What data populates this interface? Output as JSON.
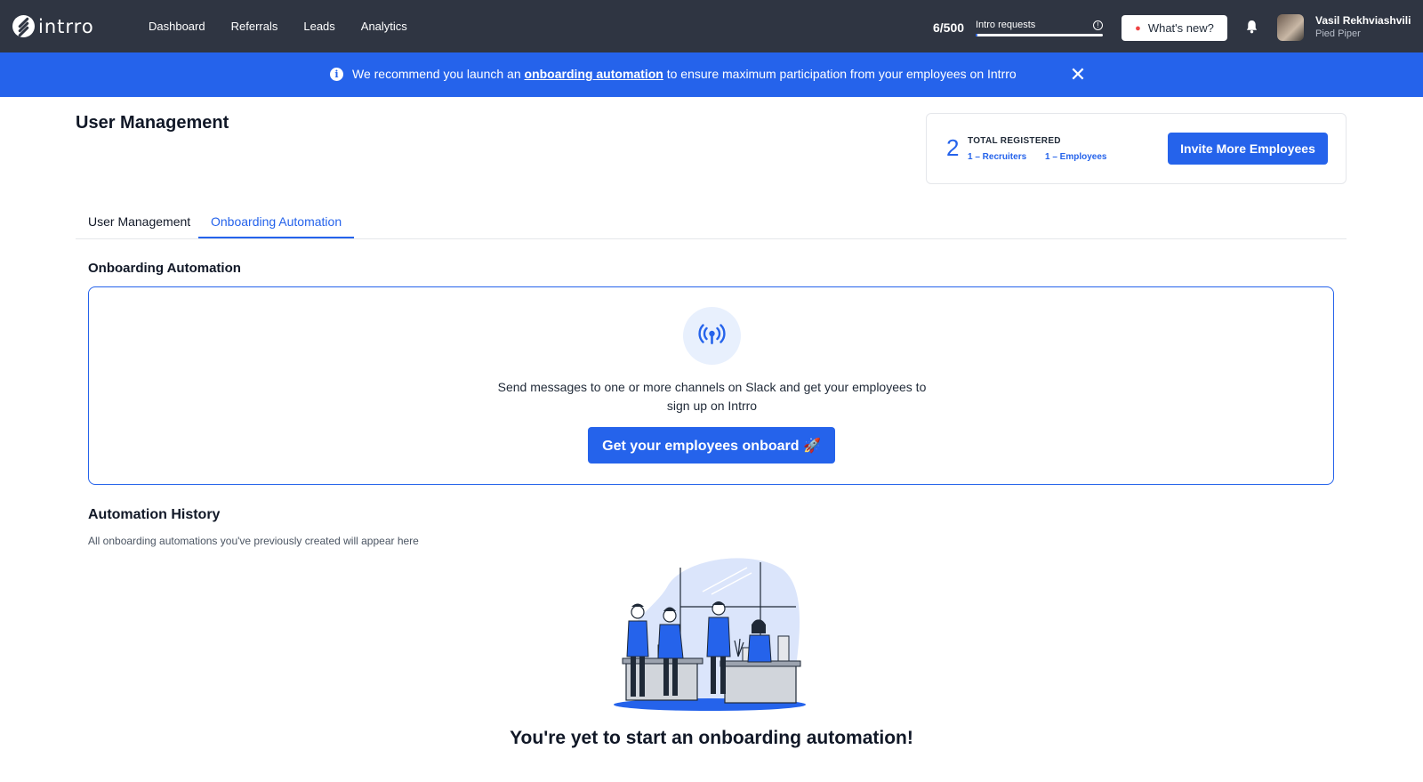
{
  "topbar": {
    "logo_text": "intrro",
    "nav": [
      {
        "label": "Dashboard"
      },
      {
        "label": "Referrals"
      },
      {
        "label": "Leads"
      },
      {
        "label": "Analytics"
      }
    ],
    "requests": {
      "count_text": "6/500",
      "label": "Intro requests",
      "used": 6,
      "limit": 500
    },
    "whats_new_label": "What's new?",
    "user": {
      "name": "Vasil Rekhviashvili",
      "org": "Pied Piper"
    }
  },
  "banner": {
    "text_before": "We recommend you launch an ",
    "link_text": "onboarding automation",
    "text_after": " to ensure maximum participation from your employees on Intrro"
  },
  "page": {
    "title": "User Management"
  },
  "stats": {
    "total": "2",
    "total_label": "TOTAL REGISTERED",
    "recruiters": "1 – Recruiters",
    "employees": "1 – Employees",
    "invite_label": "Invite More Employees"
  },
  "tabs": [
    {
      "label": "User Management",
      "active": false
    },
    {
      "label": "Onboarding Automation",
      "active": true
    }
  ],
  "onboarding": {
    "section_title": "Onboarding Automation",
    "description": "Send messages to one or more channels on Slack and get your employees to sign up on Intrro",
    "button_label": "Get your employees onboard 🚀"
  },
  "history": {
    "title": "Automation History",
    "subtitle": "All onboarding automations you've previously created will appear here",
    "empty_title": "You're yet to start an onboarding automation!"
  },
  "colors": {
    "topbar": "#2f3542",
    "accent": "#2563eb",
    "banner": "#2563eb",
    "illustration_blob": "#dbe5fb"
  },
  "icons": [
    "intrro-logo-icon",
    "info-icon",
    "close-icon",
    "fire-icon",
    "bell-icon",
    "broadcast-icon",
    "team-illustration"
  ]
}
